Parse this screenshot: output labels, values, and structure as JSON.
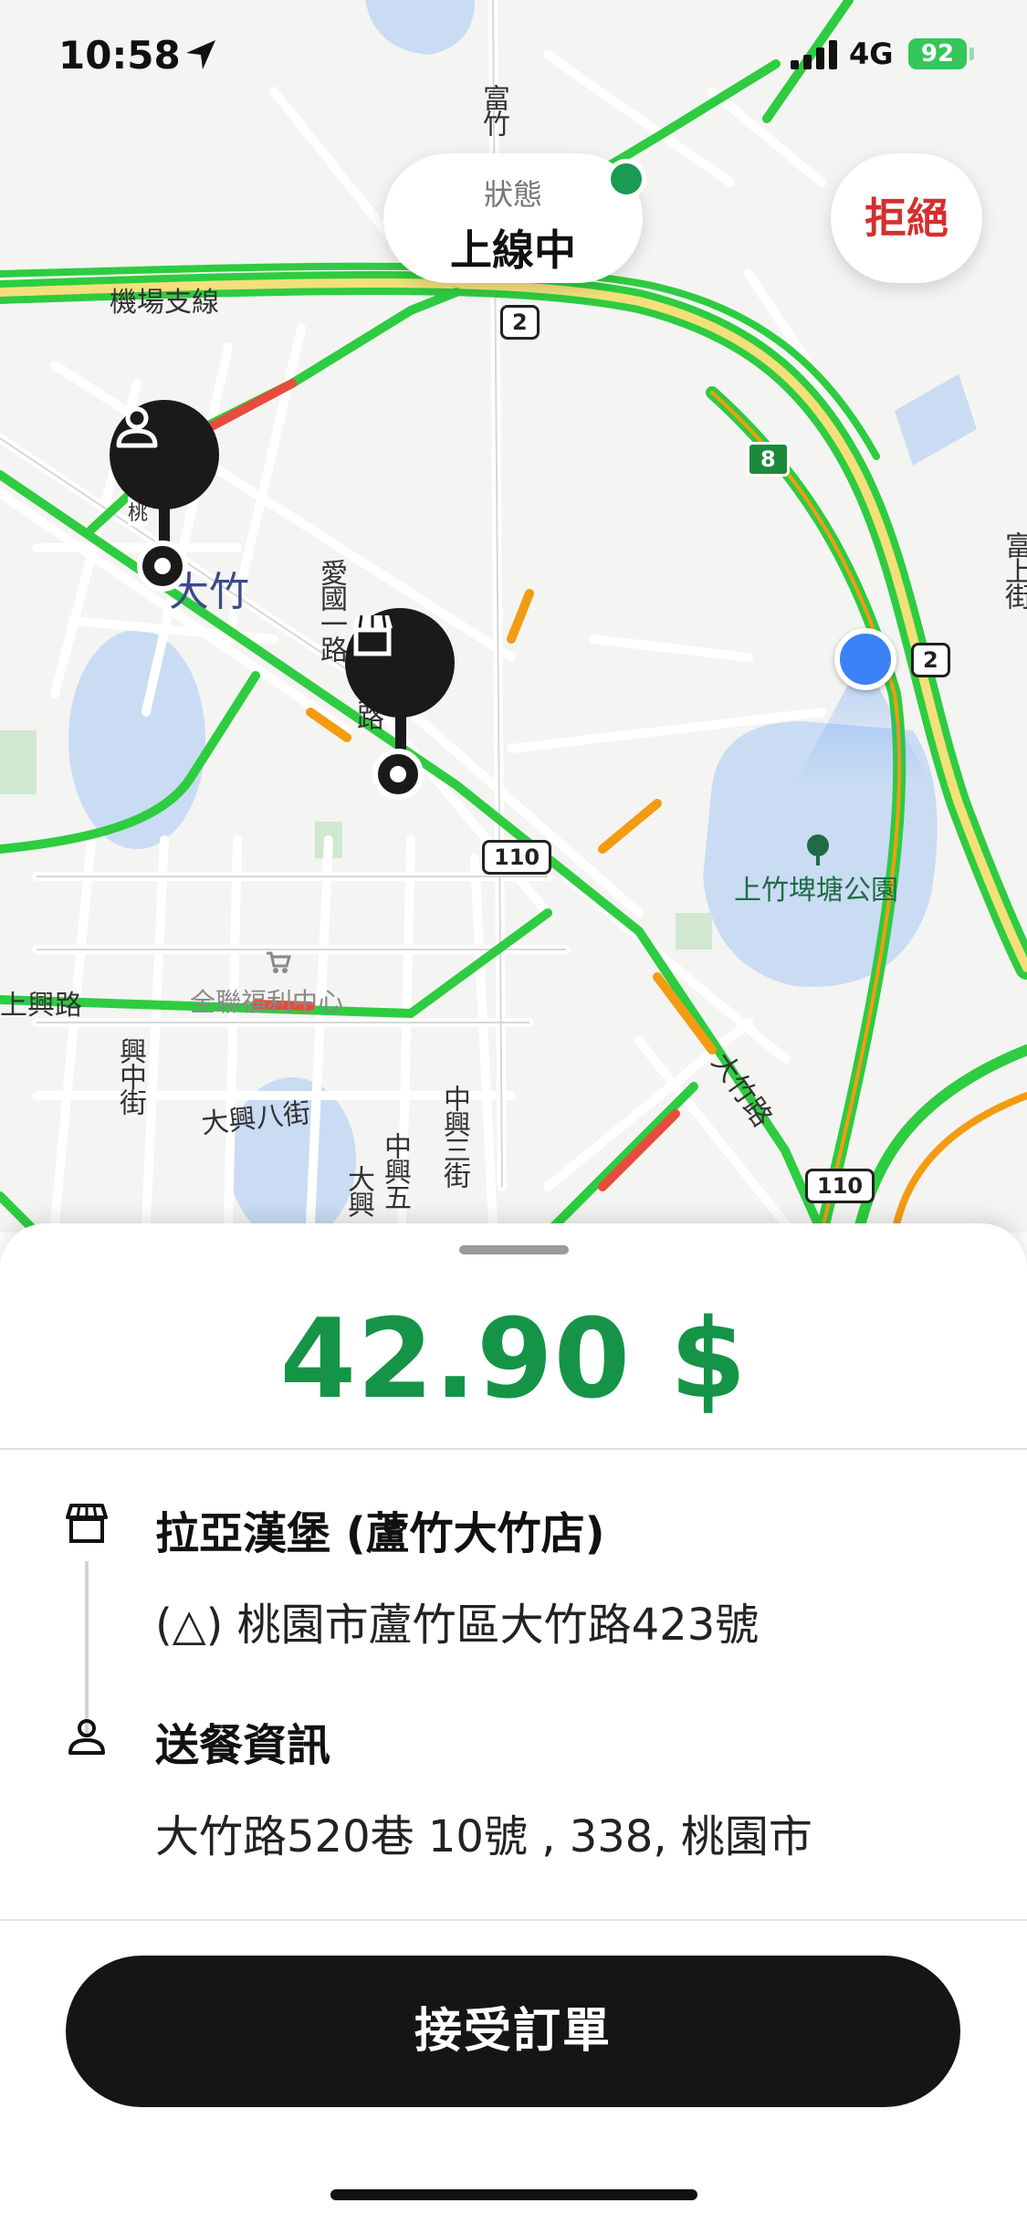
{
  "status_bar": {
    "time": "10:58",
    "network": "4G",
    "battery": "92"
  },
  "top_controls": {
    "status_caption": "狀態",
    "status_value": "上線中",
    "reject_label": "拒絕"
  },
  "map": {
    "labels": {
      "airport_line": "機場支線",
      "town": "大竹",
      "aiguo_rd": "愛國一路",
      "xingfu": "興路",
      "shangxing_rd": "上興路",
      "xingzhong_st": "興中街",
      "daxing_8th": "大興八街",
      "zhongxing_3rd": "中興三街",
      "zhongxing_5th": "中興五",
      "daxing": "大興",
      "dazhu_rd": "大竹路",
      "fuzhu": "富竹",
      "fuzhu_st": "富上街",
      "park": "上竹埤塘公園",
      "market": "全聯福利中心",
      "tao": "桃"
    },
    "shields": {
      "r2_a": "2",
      "r2_b": "2",
      "r8": "8",
      "r110_a": "110",
      "r110_b": "110"
    },
    "pin_icons": {
      "customer": "person-icon",
      "store": "store-icon"
    }
  },
  "order": {
    "price": "42.90 $",
    "store_name": "拉亞漢堡 (蘆竹大竹店)",
    "store_address": "(△) 桃園市蘆竹區大竹路423號",
    "delivery_title": "送餐資訊",
    "delivery_address": "大竹路520巷 10號 , 338, 桃園市",
    "accept_label": "接受訂單"
  },
  "colors": {
    "accent_green": "#159447",
    "reject_red": "#d32f2f",
    "button_black": "#151515",
    "traffic_green": "#2ecc40",
    "traffic_orange": "#f39c12",
    "traffic_red": "#e74c3c"
  }
}
